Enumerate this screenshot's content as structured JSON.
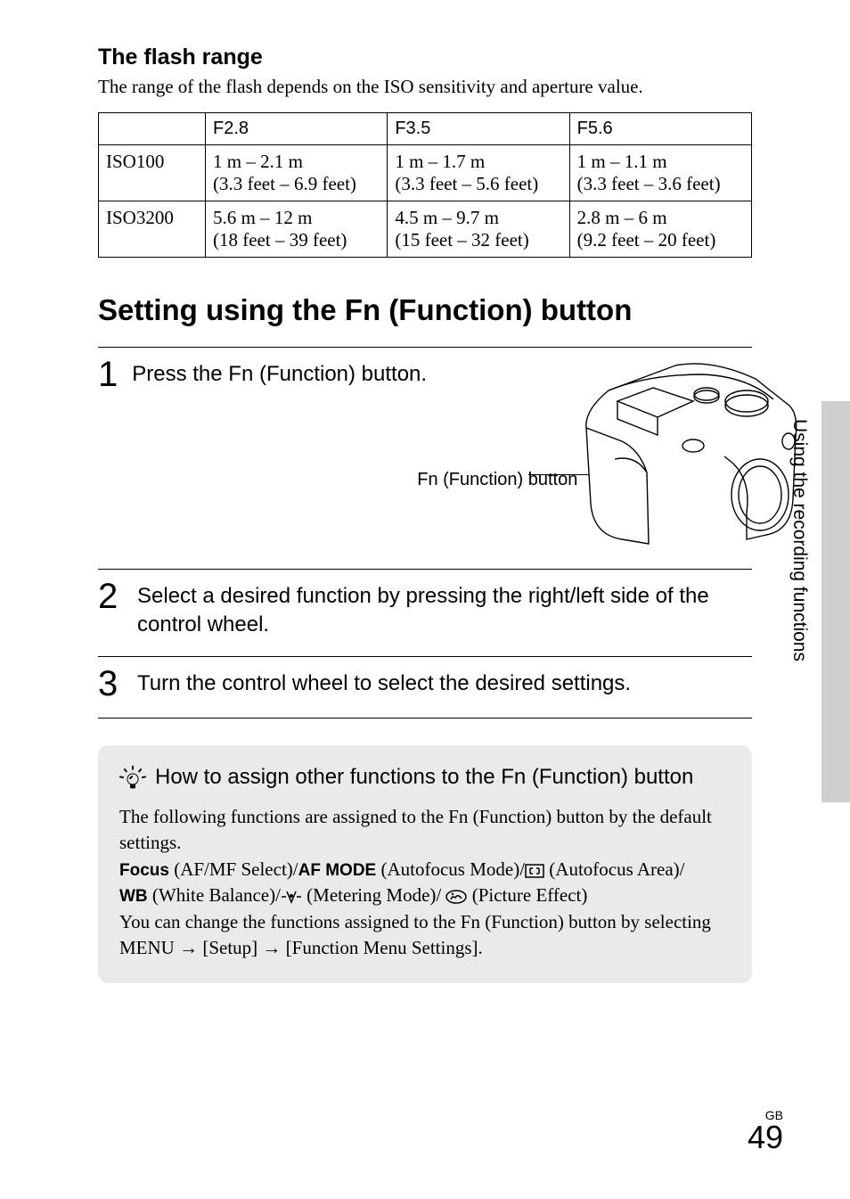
{
  "flash": {
    "heading": "The flash range",
    "desc": "The range of the flash depends on the ISO sensitivity and aperture value.",
    "cols": [
      "F2.8",
      "F3.5",
      "F5.6"
    ],
    "rows": [
      {
        "iso": "ISO100",
        "cells": [
          {
            "m": "1 m – 2.1 m",
            "ft": "(3.3 feet – 6.9 feet)"
          },
          {
            "m": "1 m – 1.7 m",
            "ft": "(3.3 feet – 5.6 feet)"
          },
          {
            "m": "1 m – 1.1 m",
            "ft": "(3.3 feet – 3.6 feet)"
          }
        ]
      },
      {
        "iso": "ISO3200",
        "cells": [
          {
            "m": "5.6 m – 12 m",
            "ft": "(18 feet – 39 feet)"
          },
          {
            "m": "4.5 m – 9.7 m",
            "ft": "(15 feet – 32 feet)"
          },
          {
            "m": "2.8 m – 6 m",
            "ft": "(9.2 feet – 20 feet)"
          }
        ]
      }
    ]
  },
  "section_title": "Setting using the Fn (Function) button",
  "steps": {
    "s1": "Press the Fn (Function) button.",
    "s2": "Select a desired function by pressing the right/left side of the control wheel.",
    "s3": "Turn the control wheel to select the desired settings."
  },
  "callout": "Fn (Function) button",
  "tip": {
    "title": "How to assign other functions to the Fn (Function) button",
    "line1": "The following functions are assigned to the Fn (Function) button by the default settings.",
    "focus_label": "Focus",
    "focus_text": " (AF/MF Select)/",
    "afmode_label": "AF MODE",
    "afmode_text": " (Autofocus Mode)/",
    "afarea_text": " (Autofocus Area)/",
    "wb_label": "WB",
    "wb_text": " (White Balance)/",
    "meter_text": " (Metering Mode)/ ",
    "pic_text": " (Picture Effect)",
    "line3a": "You can change the functions assigned to the Fn (Function) button by selecting ",
    "line3b": "MENU ",
    "line3c": " [Setup] ",
    "line3d": " [Function Menu Settings]."
  },
  "side": "Using the recording functions",
  "gb": "GB",
  "page": "49"
}
